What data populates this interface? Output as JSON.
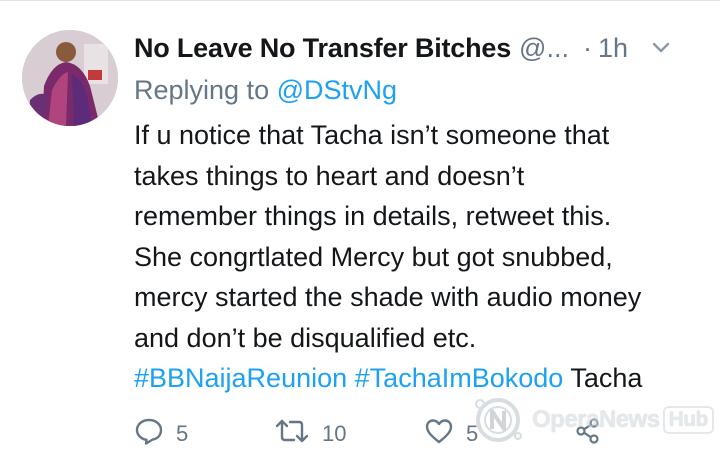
{
  "tweet": {
    "display_name": "No Leave No Transfer Bitches",
    "handle": "@...",
    "separator": "·",
    "time": "1h",
    "replying_prefix": "Replying to ",
    "replying_to": "@DStvNg",
    "body_lines": [
      "If u notice that Tacha isn’t someone that",
      "takes things to heart and doesn’t",
      "remember things in details, retweet this.",
      "She congrtlated Mercy but got snubbed,",
      "mercy started the shade with audio money",
      "and don’t be disqualified etc."
    ],
    "hashtags": [
      "#BBNaijaReunion",
      "#TachaImBokodo"
    ],
    "trailing_text": "Tacha"
  },
  "actions": {
    "reply_count": "5",
    "retweet_count": "10",
    "like_count": "5"
  },
  "watermark": {
    "brand": "OperaNews",
    "suffix": "Hub"
  },
  "icons": {
    "caret": "chevron-down-icon",
    "reply": "comment-icon",
    "retweet": "retweet-icon",
    "like": "heart-icon",
    "share": "share-icon"
  },
  "colors": {
    "text": "#14171a",
    "muted": "#657786",
    "link": "#1da1f2"
  }
}
